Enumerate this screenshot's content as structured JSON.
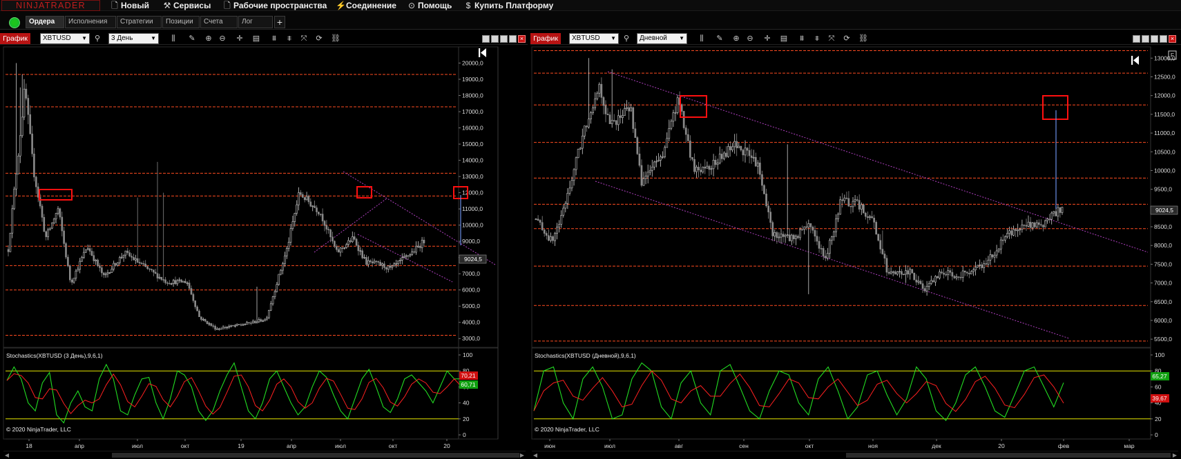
{
  "app": {
    "logo": "NINJATRADER",
    "menu": [
      {
        "label": "Новый",
        "icon": "new-document-icon",
        "glyph": "🗋"
      },
      {
        "label": "Сервисы",
        "icon": "services-icon",
        "glyph": "⚒"
      },
      {
        "label": "Рабочие пространства",
        "icon": "workspace-icon",
        "glyph": "🗋"
      },
      {
        "label": "Соединение",
        "icon": "connection-icon",
        "glyph": "⚡"
      },
      {
        "label": "Помощь",
        "icon": "help-icon",
        "glyph": "⊙"
      },
      {
        "label": "Купить Платформу",
        "icon": "dollar-icon",
        "glyph": "$"
      }
    ]
  },
  "control_center": {
    "tabs": [
      "Ордера",
      "Исполнения",
      "Стратегии",
      "Позиции",
      "Счета",
      "Лог"
    ],
    "active_tab": 0,
    "add_tab_label": "+"
  },
  "left_panel": {
    "title": "График",
    "instrument": "XBTUSD",
    "interval": "3 День",
    "stoch_label": "Stochastics(XBTUSD (3 День),9,6,1)",
    "copyright": "© 2020 NinjaTrader, LLC",
    "price_tag": "9024,5",
    "k_tag": "70,21",
    "d_tag": "60,71"
  },
  "right_panel": {
    "title": "График",
    "instrument": "XBTUSD",
    "interval": "Дневной",
    "stoch_label": "Stochastics(XBTUSD (Дневной),9,6,1)",
    "copyright": "© 2020 NinjaTrader, LLC",
    "price_tag": "9024,5",
    "k_tag": "65,27",
    "d_tag": "39,67"
  },
  "colors": {
    "up_candle": "#cfcfcf",
    "down_candle": "#8a8a8a",
    "resistance_line": "#ff4b20",
    "trend_line": "#b040c0",
    "stoch_k": "#22dd22",
    "stoch_d": "#ff2020",
    "stoch_band": "#e8e800",
    "highlight_box": "#ff1010",
    "price_tag": "#2a2a2a",
    "k_tag_color": "#d01010",
    "d_tag_color": "#10a010"
  },
  "chart_data": [
    {
      "type": "candlestick",
      "panel": "left",
      "instrument": "XBTUSD",
      "interval": "3 День",
      "ylim": [
        2500,
        21000
      ],
      "y_ticks": [
        "20000,0",
        "19000,0",
        "18000,0",
        "17000,0",
        "16000,0",
        "15000,0",
        "14000,0",
        "13000,0",
        "12000,0",
        "11000,0",
        "10000,0",
        "9000,0",
        "8000,0",
        "7000,0",
        "6000,0",
        "5000,0",
        "4000,0",
        "3000,0"
      ],
      "x_ticks": [
        "18",
        "апр",
        "июл",
        "окт",
        "19",
        "апр",
        "июл",
        "окт",
        "20"
      ],
      "x": [
        "18",
        "апр",
        "июл",
        "окт",
        "19",
        "апр",
        "июл",
        "окт",
        "20"
      ],
      "close": [
        13800,
        8500,
        6500,
        6500,
        3800,
        5200,
        11000,
        8500,
        9024.5
      ],
      "high": [
        20000,
        17200,
        8300,
        7700,
        4200,
        8600,
        13900,
        10300,
        9200
      ],
      "low": [
        5900,
        6600,
        5800,
        6200,
        3100,
        3800,
        9200,
        6500,
        6900
      ],
      "last_price": 9024.5,
      "resistance_levels": [
        19300,
        17300,
        13200,
        11800,
        10000,
        8700,
        7500,
        6000,
        3200
      ],
      "highlight_price": 11850,
      "stochastics": {
        "params": "9,6,1",
        "ylim": [
          0,
          100
        ],
        "y_ticks": [
          "100",
          "80",
          "60",
          "40",
          "20",
          "0"
        ],
        "bands": [
          80,
          20
        ],
        "k_last": 70.21,
        "d_last": 60.71
      }
    },
    {
      "type": "candlestick",
      "panel": "right",
      "instrument": "XBTUSD",
      "interval": "Дневной",
      "ylim": [
        5300,
        13300
      ],
      "y_ticks": [
        "13000,0",
        "12500,0",
        "12000,0",
        "11500,0",
        "11000,0",
        "10500,0",
        "10000,0",
        "9500,0",
        "9000,0",
        "8500,0",
        "8000,0",
        "7500,0",
        "7000,0",
        "6500,0",
        "6000,0",
        "5500,0"
      ],
      "x_ticks": [
        "июн",
        "июл",
        "авг",
        "сен",
        "окт",
        "ноя",
        "дек",
        "20",
        "фев",
        "мар"
      ],
      "x": [
        "июн",
        "июл",
        "авг",
        "сен",
        "окт",
        "ноя",
        "дек",
        "20",
        "фев"
      ],
      "close": [
        8500,
        11500,
        10500,
        10300,
        8200,
        9100,
        7200,
        7400,
        9024.5
      ],
      "high": [
        9100,
        13100,
        12300,
        10900,
        8800,
        10500,
        7700,
        8800,
        9600
      ],
      "low": [
        7500,
        9800,
        9400,
        9200,
        7500,
        8500,
        6500,
        6800,
        8300
      ],
      "last_price": 9024.5,
      "resistance_levels": [
        13200,
        12600,
        11750,
        10750,
        9800,
        9100,
        8450,
        7450,
        6400,
        5450
      ],
      "highlight_price": 12000,
      "stochastics": {
        "params": "9,6,1",
        "ylim": [
          0,
          100
        ],
        "y_ticks": [
          "100",
          "80",
          "60",
          "40",
          "20",
          "0"
        ],
        "bands": [
          80,
          20
        ],
        "k_last": 65.27,
        "d_last": 39.67
      }
    }
  ]
}
